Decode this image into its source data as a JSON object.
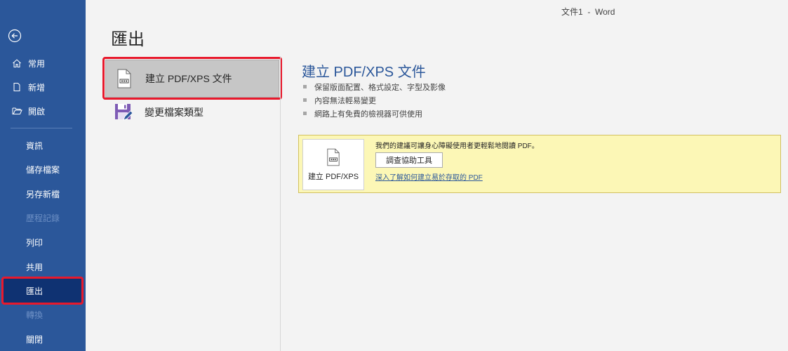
{
  "app": {
    "window_title": "文件1  -  Word"
  },
  "sidebar": {
    "top_items": [
      {
        "label": "常用",
        "icon": "home-icon"
      },
      {
        "label": "新增",
        "icon": "new-document-icon"
      },
      {
        "label": "開啟",
        "icon": "open-folder-icon"
      }
    ],
    "items": [
      {
        "label": "資訊",
        "state": "normal"
      },
      {
        "label": "儲存檔案",
        "state": "normal"
      },
      {
        "label": "另存新檔",
        "state": "normal"
      },
      {
        "label": "歷程記錄",
        "state": "disabled"
      },
      {
        "label": "列印",
        "state": "normal"
      },
      {
        "label": "共用",
        "state": "normal"
      },
      {
        "label": "匯出",
        "state": "selected"
      },
      {
        "label": "轉換",
        "state": "disabled"
      },
      {
        "label": "關閉",
        "state": "normal"
      }
    ]
  },
  "page": {
    "title": "匯出"
  },
  "options": [
    {
      "label": "建立 PDF/XPS 文件",
      "icon": "pdf-document-icon",
      "selected": true
    },
    {
      "label": "變更檔案類型",
      "icon": "save-as-type-icon",
      "selected": false
    }
  ],
  "detail": {
    "title": "建立 PDF/XPS 文件",
    "bullets": [
      "保留版面配置、格式設定、字型及影像",
      "內容無法輕易變更",
      "網路上有免費的檢視器可供使用"
    ],
    "tip": {
      "button_label": "建立 PDF/XPS",
      "text": "我們的建議可讓身心障礙使用者更輕鬆地閱讀 PDF。",
      "check_button": "調查協助工具",
      "link": "深入了解如何建立易於存取的 PDF"
    }
  },
  "colors": {
    "sidebar": "#2b579a",
    "selected_nav": "#0f3272",
    "highlight": "#e8192c",
    "tip_bg": "#fcf7b6"
  }
}
